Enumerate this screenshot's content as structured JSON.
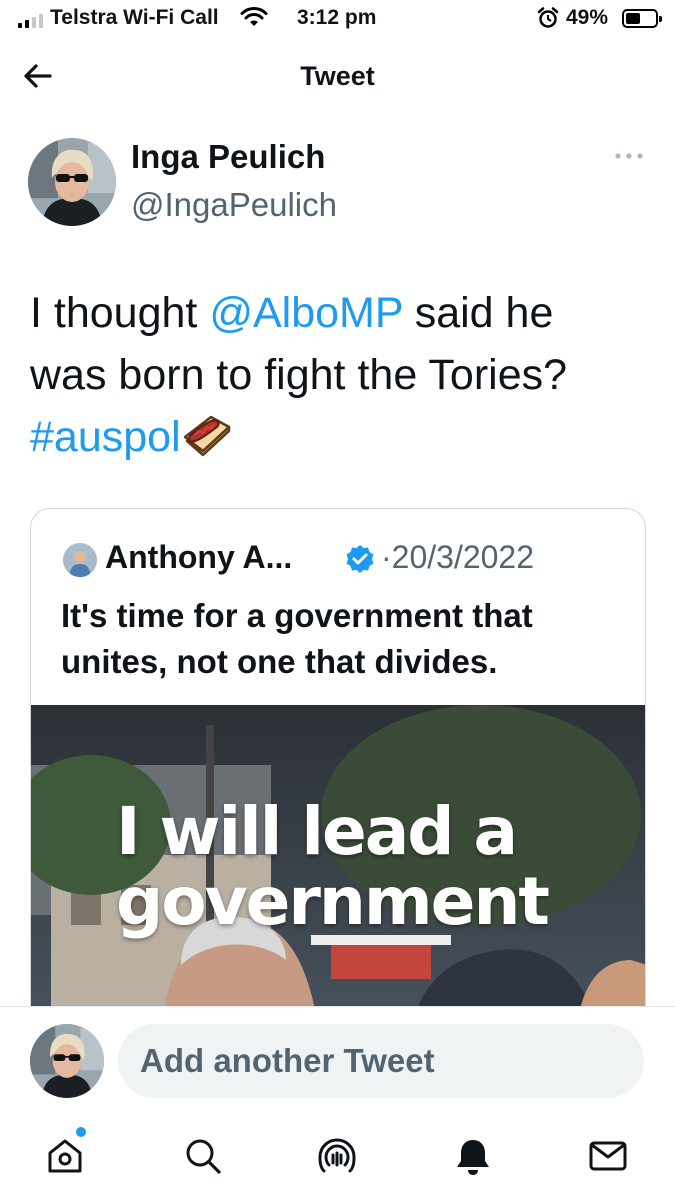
{
  "status_bar": {
    "carrier": "Telstra Wi-Fi Call",
    "time": "3:12 pm",
    "battery": "49%",
    "battery_level": 0.49
  },
  "header": {
    "title": "Tweet",
    "back_icon": "arrow-left-icon"
  },
  "tweet": {
    "author_name": "Inga Peulich",
    "author_handle": "@IngaPeulich",
    "text_1": "I thought ",
    "mention": "@AlboMP",
    "text_2": " said he was born to fight the Tories? ",
    "hashtag": "#auspol",
    "emoji": "hotdog-sandwich-icon"
  },
  "quoted_tweet": {
    "author_name": "Anthony A...",
    "separator": "·",
    "date": "20/3/2022",
    "text": "It's time for a government that unites, not one that divides.",
    "media_overlay_line1": "I will lead a",
    "media_overlay_line2": "government"
  },
  "compose": {
    "placeholder": "Add another Tweet"
  },
  "nav": {
    "items": [
      "home-icon",
      "search-icon",
      "spaces-icon",
      "notifications-icon",
      "messages-icon"
    ]
  },
  "colors": {
    "accent": "#1d9bf0",
    "secondary_text": "#536471",
    "border": "#cfd9de"
  }
}
